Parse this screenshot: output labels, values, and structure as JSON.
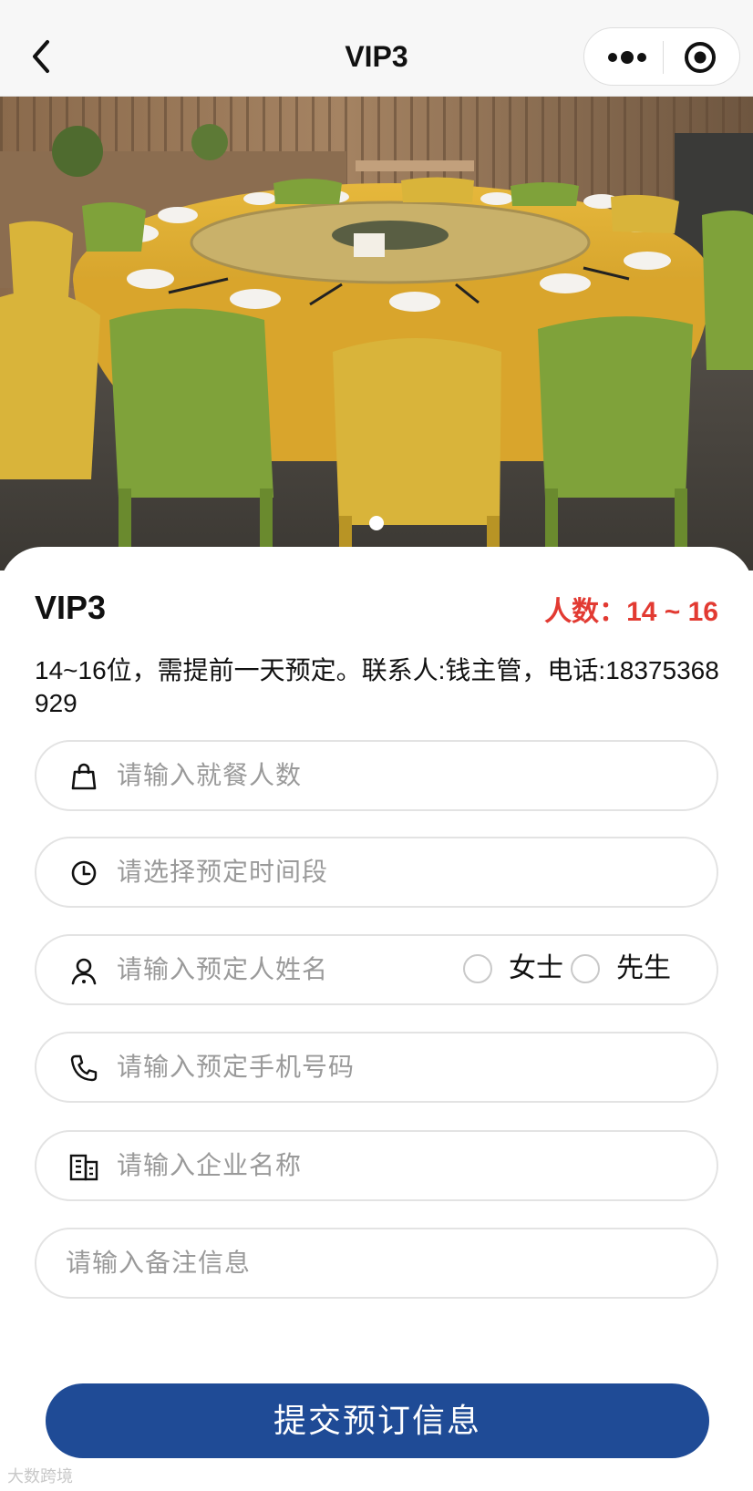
{
  "nav": {
    "title": "VIP3",
    "back_icon": "chevron-left-icon",
    "more_icon": "more-dots-icon",
    "close_icon": "target-close-icon"
  },
  "banner": {
    "image": "round dining table with yellow tablecloth and green/yellow chairs",
    "slide_count": 1,
    "active_slide": 1
  },
  "room": {
    "name": "VIP3",
    "capacity_label": "人数：",
    "capacity_value": "14 ~ 16",
    "description": "14~16位，需提前一天预定。联系人:钱主管，电话:18375368929"
  },
  "form": {
    "guests": {
      "placeholder": "请输入就餐人数",
      "icon": "bag-icon"
    },
    "time_slot": {
      "placeholder": "请选择预定时间段",
      "icon": "clock-icon"
    },
    "name": {
      "placeholder": "请输入预定人姓名",
      "icon": "user-icon",
      "options": [
        "女士",
        "先生"
      ]
    },
    "phone": {
      "placeholder": "请输入预定手机号码",
      "icon": "phone-icon"
    },
    "company": {
      "placeholder": "请输入企业名称",
      "icon": "building-icon"
    },
    "remarks": {
      "placeholder": "请输入备注信息"
    },
    "submit_label": "提交预订信息"
  },
  "colors": {
    "accent": "#1f4b96",
    "capacity": "#e23a32",
    "placeholder": "#9a9a9a",
    "border": "#e3e3e3"
  },
  "watermark": "大数跨境"
}
